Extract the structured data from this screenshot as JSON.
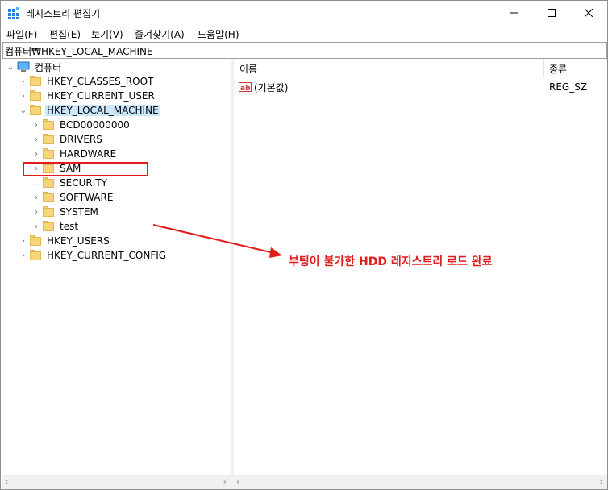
{
  "window": {
    "title": "레지스트리 편집기"
  },
  "menu": [
    "파일(F)",
    "편집(E)",
    "보기(V)",
    "즐겨찾기(A)",
    "도움말(H)"
  ],
  "address": "컴퓨터₩HKEY_LOCAL_MACHINE",
  "tree": {
    "root": "컴퓨터",
    "hives": [
      "HKEY_CLASSES_ROOT",
      "HKEY_CURRENT_USER",
      "HKEY_LOCAL_MACHINE"
    ],
    "hklm_children": [
      "BCD00000000",
      "DRIVERS",
      "HARDWARE",
      "SAM",
      "SECURITY",
      "SOFTWARE",
      "SYSTEM",
      "test"
    ],
    "hives_after": [
      "HKEY_USERS",
      "HKEY_CURRENT_CONFIG"
    ]
  },
  "list": {
    "columns": {
      "name": "이름",
      "type": "종류"
    },
    "rows": [
      {
        "name": "(기본값)",
        "type": "REG_SZ"
      }
    ]
  },
  "annotation": "부팅이 불가한 HDD 레지스트리 로드 완료",
  "colors": {
    "annotation": "#e21b1b",
    "selection": "#cce8ff",
    "folder": "#f6d679"
  }
}
